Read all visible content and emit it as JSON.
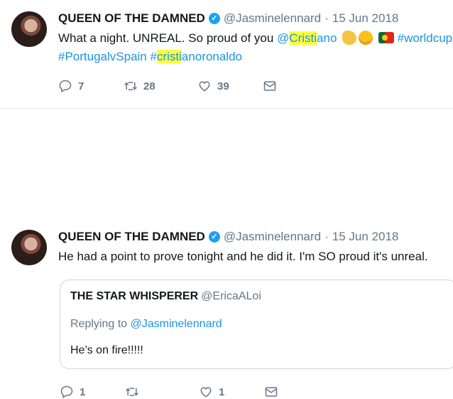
{
  "tweets": [
    {
      "name": "QUEEN OF THE DAMNED",
      "handle": "@Jasminelennard",
      "dot": "·",
      "date": "15 Jun 2018",
      "text": {
        "before": "What a night. UNREAL. So proud of you ",
        "mention_at": "@",
        "mention_hl": "Cristi",
        "mention_rest": "ano",
        "hashtag_worldcup": "#worldcup",
        "hashtag_match": "#PortugalvSpain",
        "hashtag2_hash": "#",
        "hashtag2_hl": "cristi",
        "hashtag2_rest": "anoronaldo"
      },
      "emojis": [
        "clapping-hands",
        "smiling-face",
        "portugal-flag"
      ],
      "actions": {
        "replies": "7",
        "retweets": "28",
        "likes": "39"
      }
    },
    {
      "name": "QUEEN OF THE DAMNED",
      "handle": "@Jasminelennard",
      "dot": "·",
      "date": "15 Jun 2018",
      "text": "He had a point to prove tonight and he did it. I'm SO proud it's unreal.",
      "quote": {
        "name": "THE STAR WHISPERER",
        "handle": "@EricaALoi",
        "replying_prefix": "Replying to ",
        "replying_to": "@Jasminelennard",
        "text": "He’s on fire!!!!!"
      },
      "actions": {
        "replies": "1",
        "retweets": "",
        "likes": "1"
      }
    }
  ],
  "colors": {
    "link": "#1b95e0",
    "highlight": "#ffff3b",
    "verified": "#1da1f2",
    "muted": "#657786"
  }
}
